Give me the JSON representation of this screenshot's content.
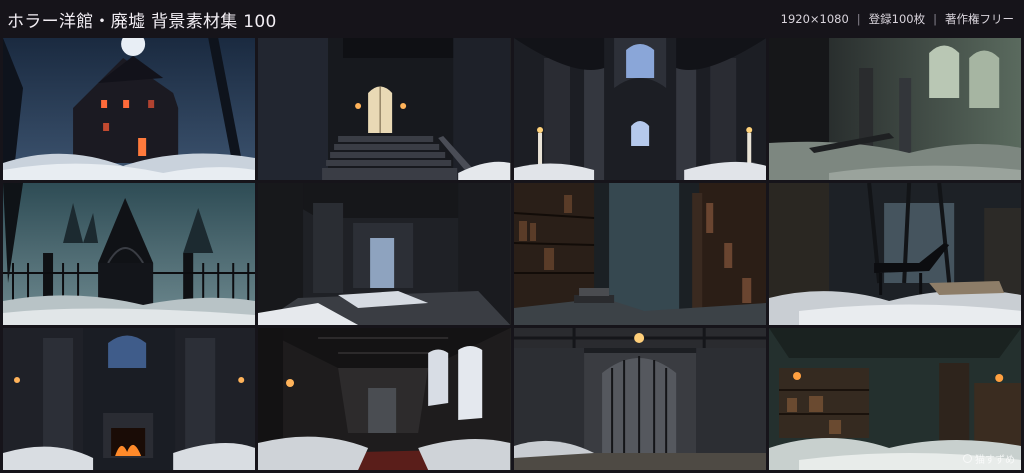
{
  "header": {
    "title": "ホラー洋館・廃墟 背景素材集 100",
    "resolution": "1920×1080",
    "separator": "|",
    "count": "登録100枚",
    "license": "著作権フリー"
  },
  "thumbnails": [
    {
      "scene": "haunted-mansion-exterior"
    },
    {
      "scene": "grand-staircase"
    },
    {
      "scene": "gothic-chapel"
    },
    {
      "scene": "ruined-great-hall"
    },
    {
      "scene": "iron-gate-courtyard"
    },
    {
      "scene": "abandoned-room"
    },
    {
      "scene": "dusty-library"
    },
    {
      "scene": "piano-room"
    },
    {
      "scene": "fireplace-hall"
    },
    {
      "scene": "long-corridor"
    },
    {
      "scene": "gated-cellar"
    },
    {
      "scene": "storage-room"
    }
  ],
  "watermark": {
    "text": "猫すずめ"
  },
  "colors": {
    "background": "#16141a",
    "text": "#e8e4ea",
    "accent_warm": "#ff9a3c"
  }
}
